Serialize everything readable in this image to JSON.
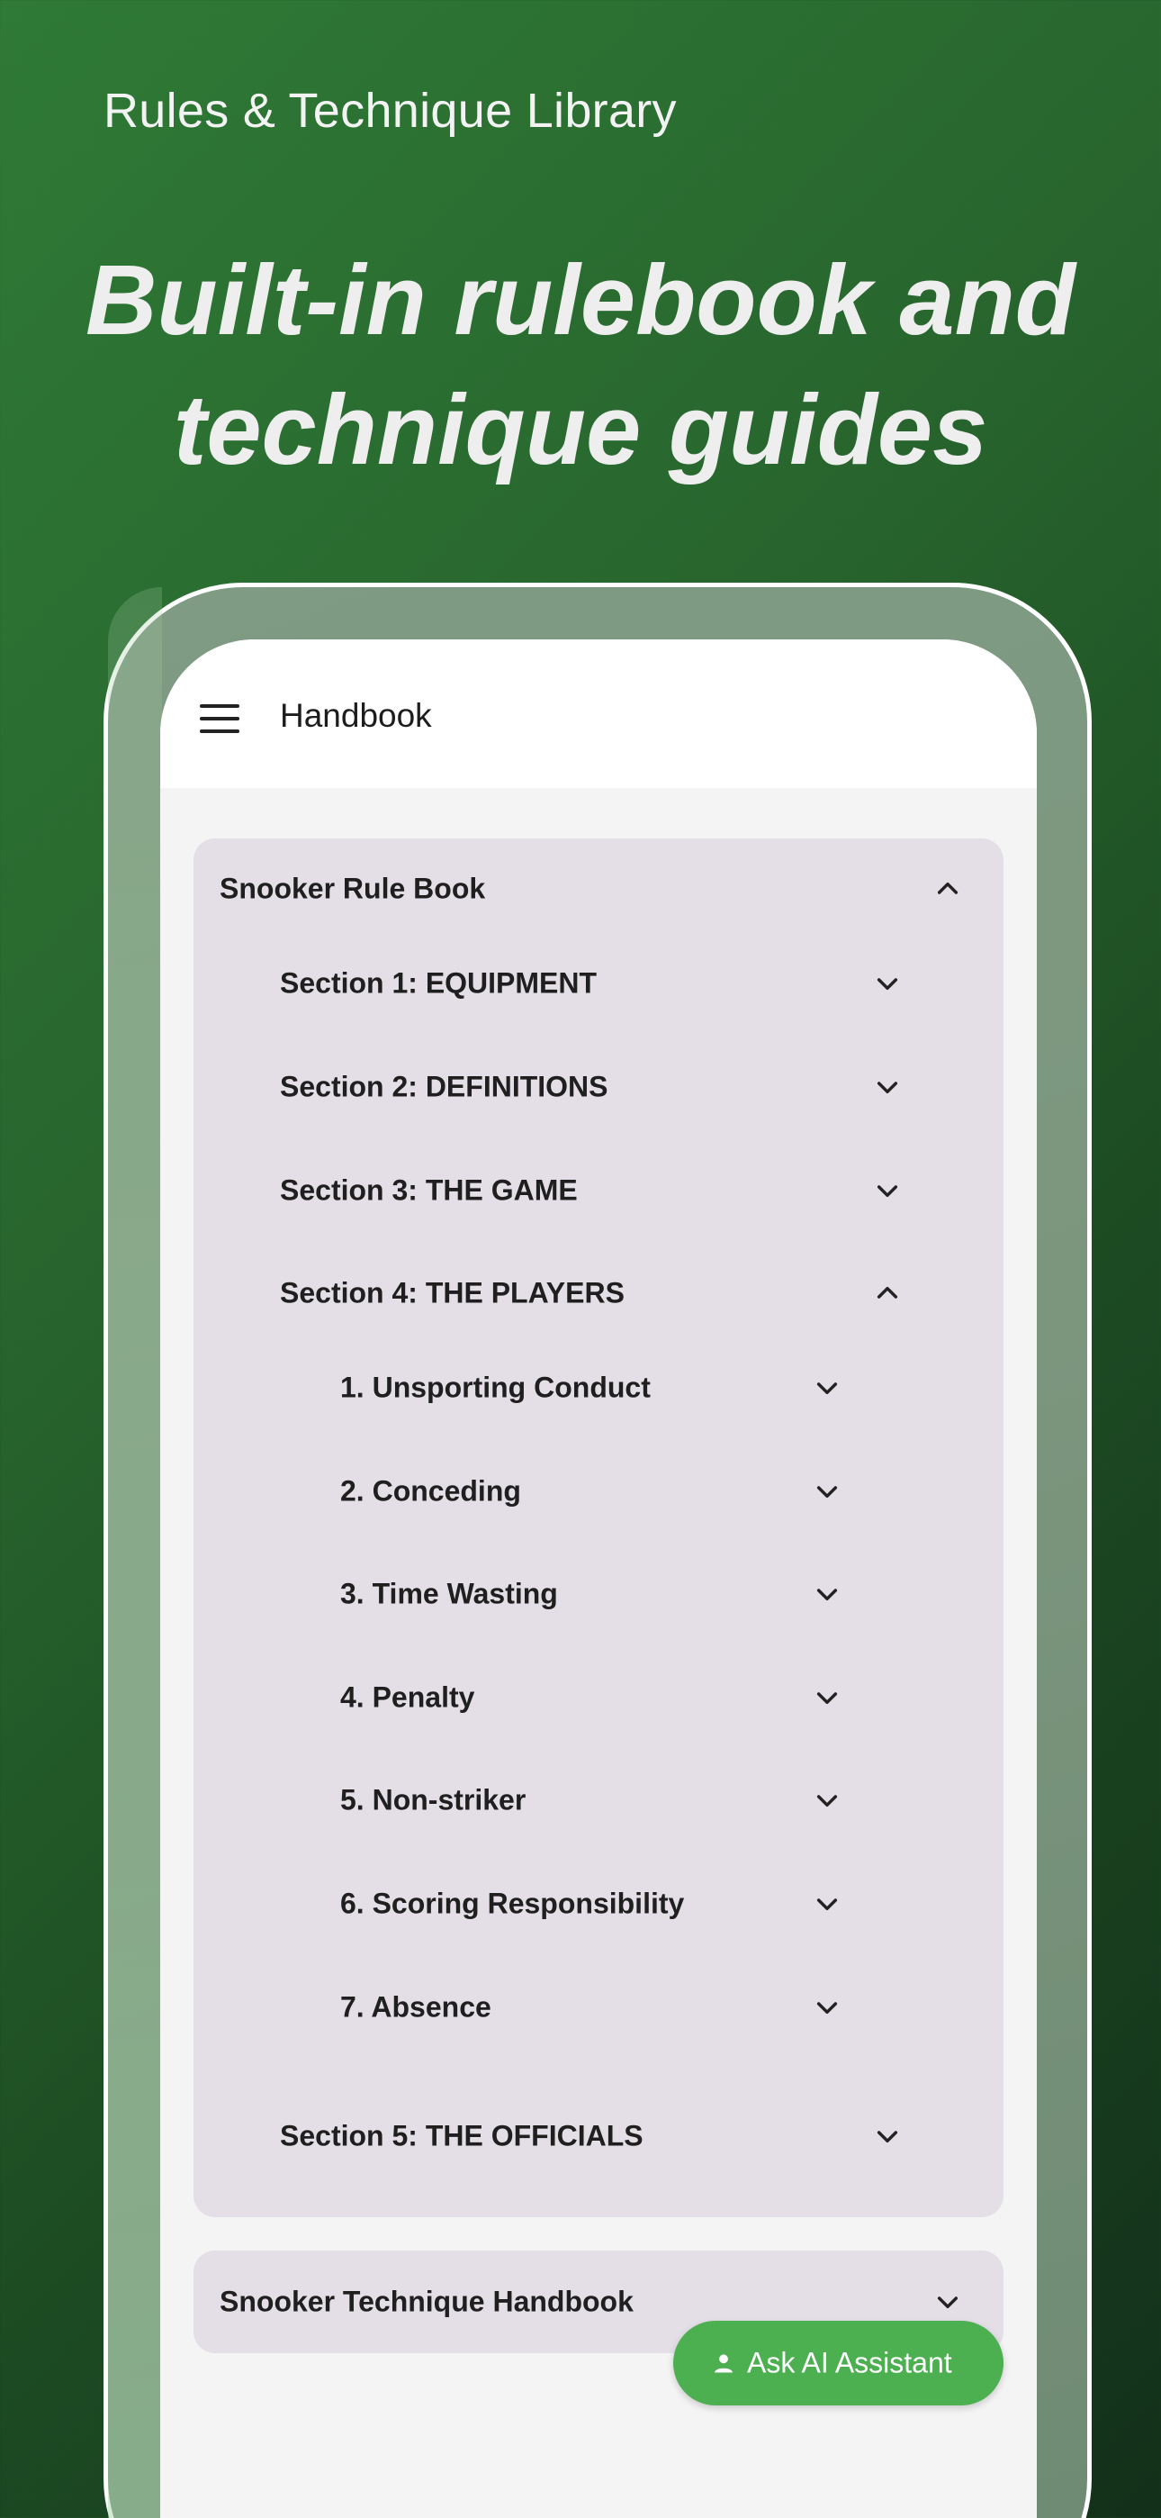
{
  "caption": "Rules & Technique Library",
  "headline": {
    "line1": "Built-in rulebook and",
    "line2": "technique guides"
  },
  "appbar": {
    "title": "Handbook",
    "menu_icon": "hamburger-menu-icon"
  },
  "rule_book": {
    "title": "Snooker Rule Book",
    "expanded": true,
    "sections": [
      {
        "label": "Section 1: EQUIPMENT",
        "expanded": false
      },
      {
        "label": "Section 2: DEFINITIONS",
        "expanded": false
      },
      {
        "label": "Section 3: THE GAME",
        "expanded": false
      },
      {
        "label": "Section 4: THE PLAYERS",
        "expanded": true,
        "items": [
          {
            "label": "1. Unsporting Conduct"
          },
          {
            "label": "2. Conceding"
          },
          {
            "label": "3. Time Wasting"
          },
          {
            "label": "4. Penalty"
          },
          {
            "label": "5. Non-striker"
          },
          {
            "label": "6. Scoring Responsibility"
          },
          {
            "label": "7. Absence"
          }
        ]
      },
      {
        "label": "Section 5: THE OFFICIALS",
        "expanded": false
      }
    ]
  },
  "technique_handbook": {
    "title": "Snooker Technique Handbook",
    "expanded": false
  },
  "fab": {
    "label": "Ask AI Assistant",
    "icon": "person-icon",
    "color": "#4caf50"
  },
  "colors": {
    "background_green": "#2f7a36",
    "card_bg": "#e4dfe7",
    "screen_bg": "#f4f4f4"
  }
}
